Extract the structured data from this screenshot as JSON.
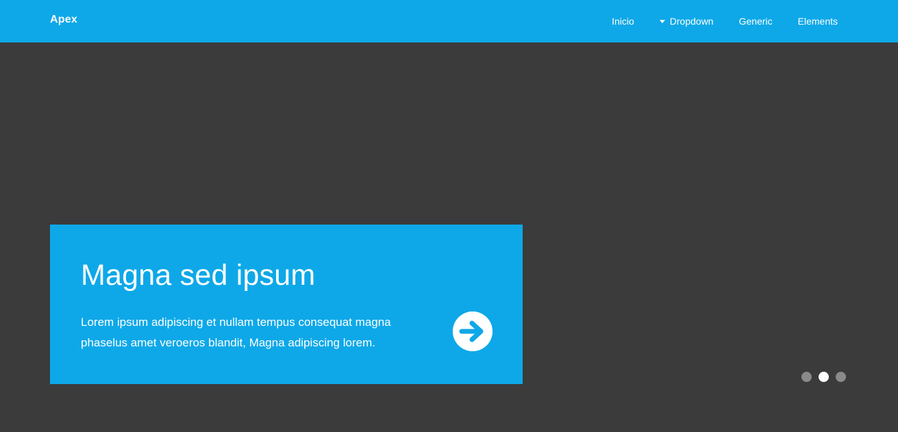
{
  "header": {
    "brand": "Apex",
    "nav": [
      {
        "label": "Inicio",
        "icon": ""
      },
      {
        "label": "Dropdown",
        "icon": "caret-down-icon"
      },
      {
        "label": "Generic",
        "icon": ""
      },
      {
        "label": "Elements",
        "icon": ""
      }
    ]
  },
  "hero": {
    "card": {
      "title": "Magna sed ipsum",
      "text_line1": "Lorem ipsum adipiscing et nullam tempus consequat magna",
      "text_line2": "phaselus amet veroeros blandit, Magna adipiscing lorem.",
      "button_icon": "arrow-right-circle-icon"
    },
    "slider": {
      "slide_count": 3,
      "active_index": 1
    }
  },
  "colors": {
    "accent": "#0ea8e8",
    "background": "#3b3b3b",
    "dot_inactive": "#8a8a8a",
    "dot_active": "#ffffff"
  }
}
